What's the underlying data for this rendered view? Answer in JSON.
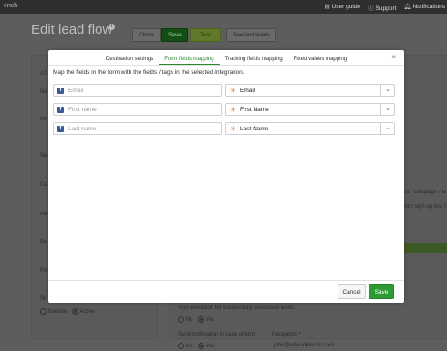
{
  "topbar": {
    "brand": "ench",
    "links": [
      "User guide",
      "Support",
      "Notifications"
    ]
  },
  "page": {
    "title": "Edit lead flow",
    "buttons": {
      "close": "Close",
      "save": "Save",
      "test": "Test",
      "see_last": "See last leads"
    },
    "left_fragments": [
      "AT",
      "Na",
      "Int",
      "Se",
      "Ca",
      "Ad",
      "Pe",
      "Po",
      "St"
    ],
    "status": {
      "inactive": "Inactive",
      "active": "Active"
    },
    "right_fragments": [
      "ent / campaign / ai",
      "ench sign up test f"
    ],
    "skip_label": "Skip execution for successfully processed leads",
    "notify_label": "Send notification in case of error",
    "recipients_label": "Recipients *",
    "recipients_value": "john@adworkbench.com",
    "no": "No",
    "yes": "Yes"
  },
  "modal": {
    "tabs": [
      "Destination settings",
      "Form fields mapping",
      "Tracking fields mapping",
      "Fixed values mapping"
    ],
    "active_tab": 1,
    "instruction": "Map the fields in the form with the fields / tags in the selected integration.",
    "rows": [
      {
        "source": "Email",
        "target": "Email"
      },
      {
        "source": "First name",
        "target": "First Name"
      },
      {
        "source": "Last name",
        "target": "Last Name"
      }
    ],
    "cancel": "Cancel",
    "save": "Save"
  },
  "colors": {
    "accent": "#2e9a34",
    "facebook": "#3b5998",
    "zapier": "#e8742a"
  }
}
